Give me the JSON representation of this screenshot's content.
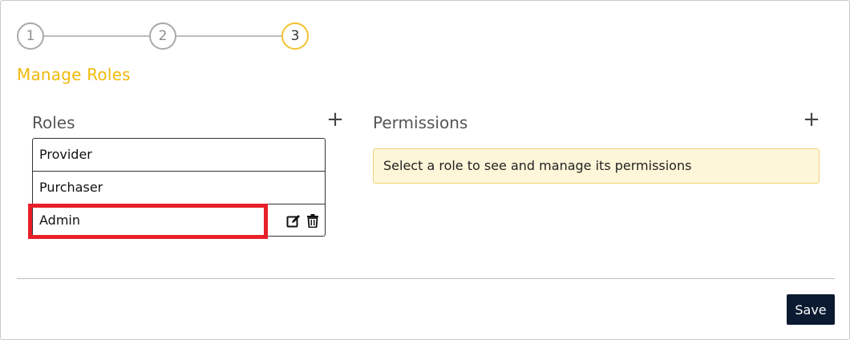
{
  "stepper": {
    "steps": [
      {
        "label": "1",
        "state": "inactive"
      },
      {
        "label": "2",
        "state": "inactive"
      },
      {
        "label": "3",
        "state": "active"
      }
    ]
  },
  "page": {
    "title": "Manage Roles"
  },
  "roles": {
    "label": "Roles",
    "add_label": "+",
    "items": [
      {
        "label": "Provider"
      },
      {
        "label": "Purchaser"
      },
      {
        "label": "Admin",
        "highlighted": true
      }
    ]
  },
  "permissions": {
    "label": "Permissions",
    "add_label": "+",
    "info_message": "Select a role to see and manage its permissions"
  },
  "footer": {
    "save_label": "Save"
  },
  "colors": {
    "accent": "#f0b90b",
    "highlight": "#e8202a",
    "save_button": "#0b1a30",
    "info_background": "#fef6d8"
  }
}
